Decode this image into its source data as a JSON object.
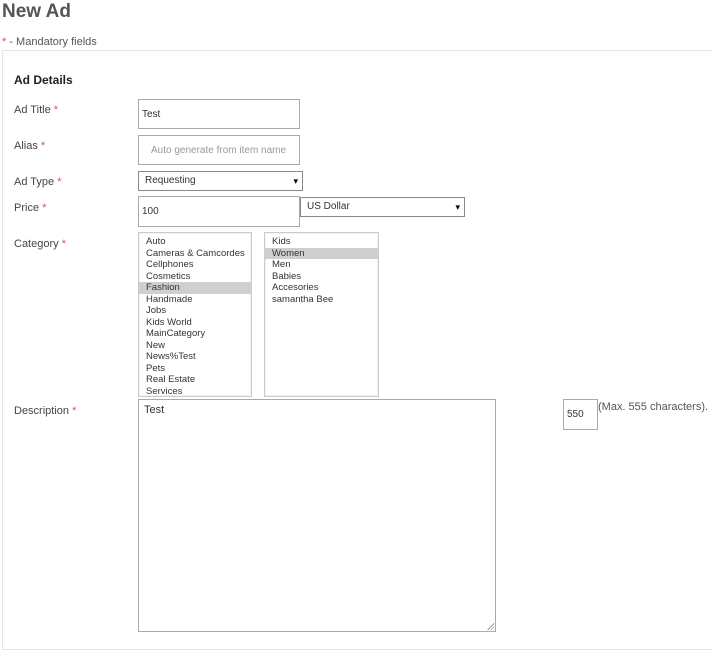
{
  "page": {
    "title": "New Ad",
    "mandatory_marker": "*",
    "mandatory_text": " -  Mandatory fields"
  },
  "section": {
    "title": "Ad Details"
  },
  "required_marker": "*",
  "fields": {
    "ad_title": {
      "label": "Ad Title",
      "value": "Test"
    },
    "alias": {
      "label": "Alias",
      "value": "",
      "placeholder": "Auto generate from item name"
    },
    "ad_type": {
      "label": "Ad Type",
      "selected": "Requesting"
    },
    "price": {
      "label": "Price",
      "value": "100",
      "currency": "US Dollar"
    },
    "category": {
      "label": "Category",
      "primary": [
        "Auto",
        "Cameras & Camcordes",
        "Cellphones",
        "Cosmetics",
        "Fashion",
        "Handmade",
        "Jobs",
        "Kids World",
        "MainCategory",
        "New",
        "News%Test",
        "Pets",
        "Real Estate",
        "Services"
      ],
      "primary_selected": "Fashion",
      "secondary": [
        "Kids",
        "Women",
        "Men",
        "Babies",
        "Accesories",
        "samantha Bee"
      ],
      "secondary_selected": "Women"
    },
    "description": {
      "label": "Description",
      "value": "Test",
      "char_count": "550",
      "max_note": "(Max. 555 characters)."
    }
  },
  "icons": {
    "dropdown": "▾"
  }
}
